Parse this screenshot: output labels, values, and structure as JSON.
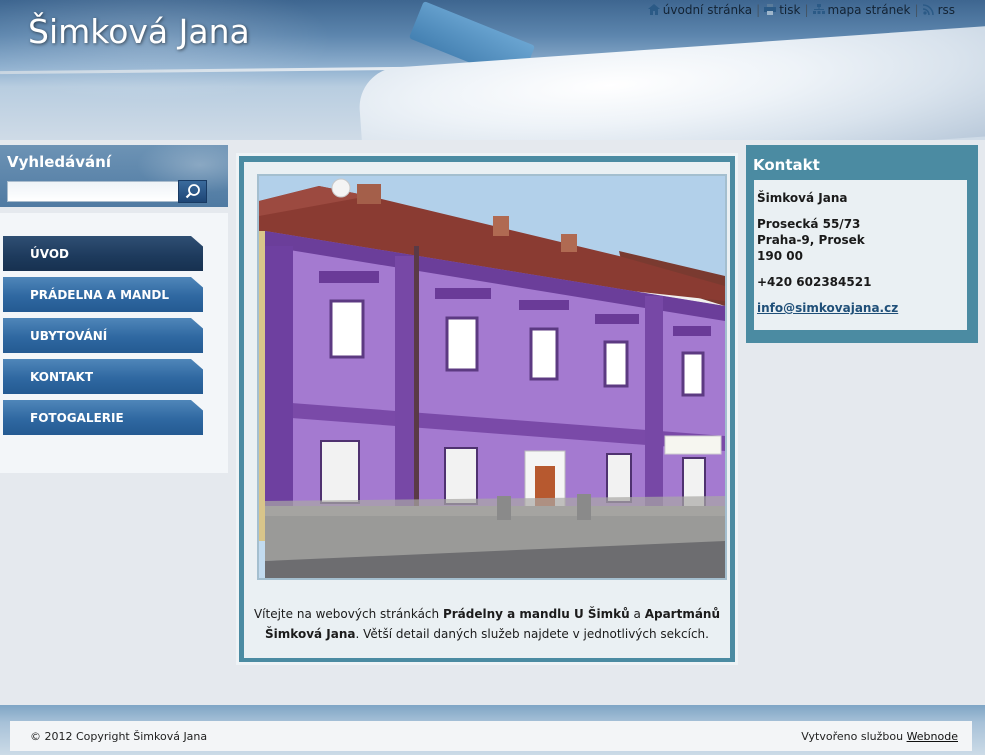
{
  "header": {
    "site_title": "Šimková Jana",
    "toplinks": {
      "home": "úvodní stránka",
      "print": "tisk",
      "sitemap": "mapa stránek",
      "rss": "rss",
      "separator": "|"
    }
  },
  "search": {
    "title": "Vyhledávání",
    "value": "",
    "button_icon": "magnifier-icon"
  },
  "menu": {
    "items": [
      {
        "label": "ÚVOD",
        "active": true
      },
      {
        "label": "PRÁDELNA A MANDL",
        "active": false
      },
      {
        "label": "UBYTOVÁNÍ",
        "active": false
      },
      {
        "label": "KONTAKT",
        "active": false
      },
      {
        "label": "FOTOGALERIE",
        "active": false
      }
    ]
  },
  "main": {
    "intro": {
      "part1": "Vítejte na webových stránkách ",
      "bold1": "Prádelny a mandlu U Šimků",
      "part2": " a ",
      "bold2": "Apartmánů Šimková Jana",
      "part3": ". Větší detail daných služeb najdete v jednotlivých sekcích."
    }
  },
  "contact": {
    "title": "Kontakt",
    "name": "Šimková Jana",
    "street": "Prosecká 55/73",
    "city": "Praha-9, Prosek",
    "zip": "190 00",
    "phone": "+420 602384521",
    "email": "info@simkovajana.cz"
  },
  "footer": {
    "copyright": "© 2012 Copyright Šimková Jana",
    "powered_text": "Vytvořeno službou ",
    "powered_link": "Webnode"
  },
  "colors": {
    "accent_teal": "#4b8ba2",
    "menu_blue": "#2f68a1",
    "menu_active": "#1d3a5c"
  }
}
